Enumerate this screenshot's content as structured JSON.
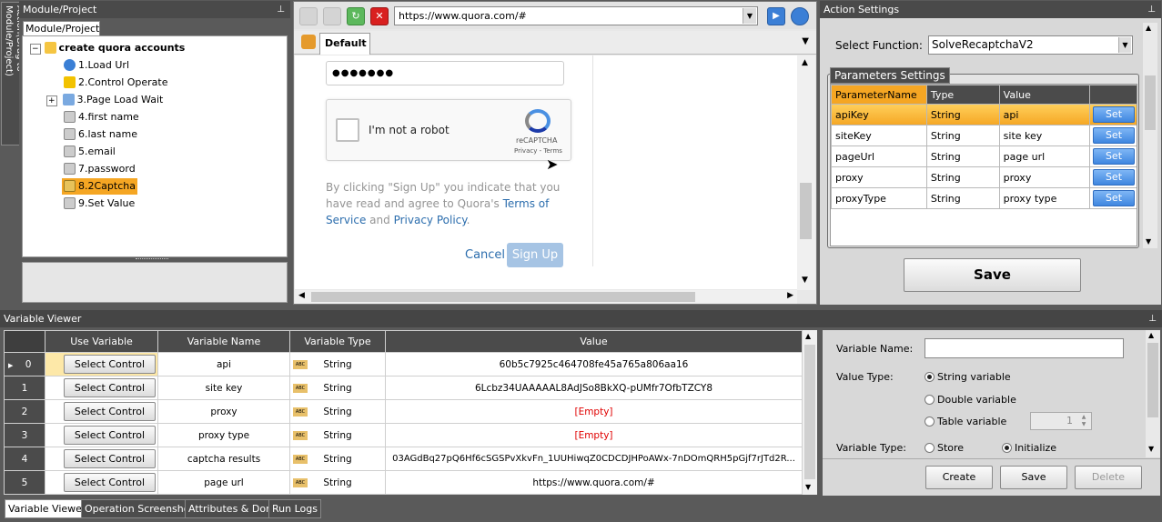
{
  "left_tab": "Action(Drag to Module/Project)",
  "module_panel": {
    "title": "Module/Project",
    "tab": "Module/Project",
    "root": "create quora accounts",
    "items": [
      "1.Load Url",
      "2.Control Operate",
      "3.Page Load Wait",
      "4.first name",
      "6.last name",
      "5.email",
      "7.password",
      "8.2Captcha",
      "9.Set Value"
    ]
  },
  "browser": {
    "url": "https://www.quora.com/#",
    "tab": "Default",
    "password_mask": "●●●●●●●",
    "recaptcha_label": "I'm not a robot",
    "recaptcha_brand": "reCAPTCHA",
    "recaptcha_links": "Privacy - Terms",
    "terms_line1": "By clicking \"Sign Up\" you indicate that you",
    "terms_line2a": "have read and agree to Quora's ",
    "terms_link1a": "Terms of",
    "terms_link1b": "Service",
    "terms_and": " and ",
    "terms_link2": "Privacy Policy",
    "terms_end": ".",
    "cancel": "Cancel",
    "signup": "Sign Up"
  },
  "action_settings": {
    "title": "Action Settings",
    "select_label": "Select Function:",
    "select_value": "SolveRecaptchaV2",
    "group": "Parameters Settings",
    "headers": [
      "ParameterName",
      "Type",
      "Value"
    ],
    "rows": [
      {
        "name": "apiKey",
        "type": "String",
        "value": "api",
        "btn": "Set"
      },
      {
        "name": "siteKey",
        "type": "String",
        "value": "site key",
        "btn": "Set"
      },
      {
        "name": "pageUrl",
        "type": "String",
        "value": "page url",
        "btn": "Set"
      },
      {
        "name": "proxy",
        "type": "String",
        "value": "proxy",
        "btn": "Set"
      },
      {
        "name": "proxyType",
        "type": "String",
        "value": "proxy type",
        "btn": "Set"
      }
    ],
    "save": "Save"
  },
  "variable_viewer": {
    "title": "Variable Viewer",
    "headers": [
      "Use Variable",
      "Variable Name",
      "Variable Type",
      "Value"
    ],
    "type_badge": "ABC",
    "rows": [
      {
        "idx": "0",
        "btn": "Select Control",
        "name": "api",
        "type": "String",
        "value": "60b5c7925c464708fe45a765a806aa16"
      },
      {
        "idx": "1",
        "btn": "Select Control",
        "name": "site key",
        "type": "String",
        "value": "6Lcbz34UAAAAAL8AdJSo8BkXQ-pUMfr7OfbTZCY8"
      },
      {
        "idx": "2",
        "btn": "Select Control",
        "name": "proxy",
        "type": "String",
        "value": "[Empty]"
      },
      {
        "idx": "3",
        "btn": "Select Control",
        "name": "proxy type",
        "type": "String",
        "value": "[Empty]"
      },
      {
        "idx": "4",
        "btn": "Select Control",
        "name": "captcha results",
        "type": "String",
        "value": "03AGdBq27pQ6Hf6cSGSPvXkvFn_1UUHiwqZ0CDCDJHPoAWx-7nDOmQRH5pGjf7rJTd2R..."
      },
      {
        "idx": "5",
        "btn": "Select Control",
        "name": "page url",
        "type": "String",
        "value": "https://www.quora.com/#"
      }
    ]
  },
  "var_form": {
    "name_label": "Variable Name:",
    "name_value": "",
    "value_type_label": "Value Type:",
    "options": [
      "String variable",
      "Double variable",
      "Table variable"
    ],
    "table_value": "1",
    "var_type_label": "Variable Type:",
    "store": "Store",
    "initialize": "Initialize",
    "create": "Create",
    "save": "Save",
    "delete": "Delete"
  },
  "bottom_tabs": [
    "Variable Viewer",
    "Operation Screenshot",
    "Attributes & Dom",
    "Run Logs"
  ],
  "colors": {
    "selected_row": "#f5a623",
    "set_button": "#3f86e0",
    "link": "#2b6dad",
    "empty": "#e00000"
  }
}
